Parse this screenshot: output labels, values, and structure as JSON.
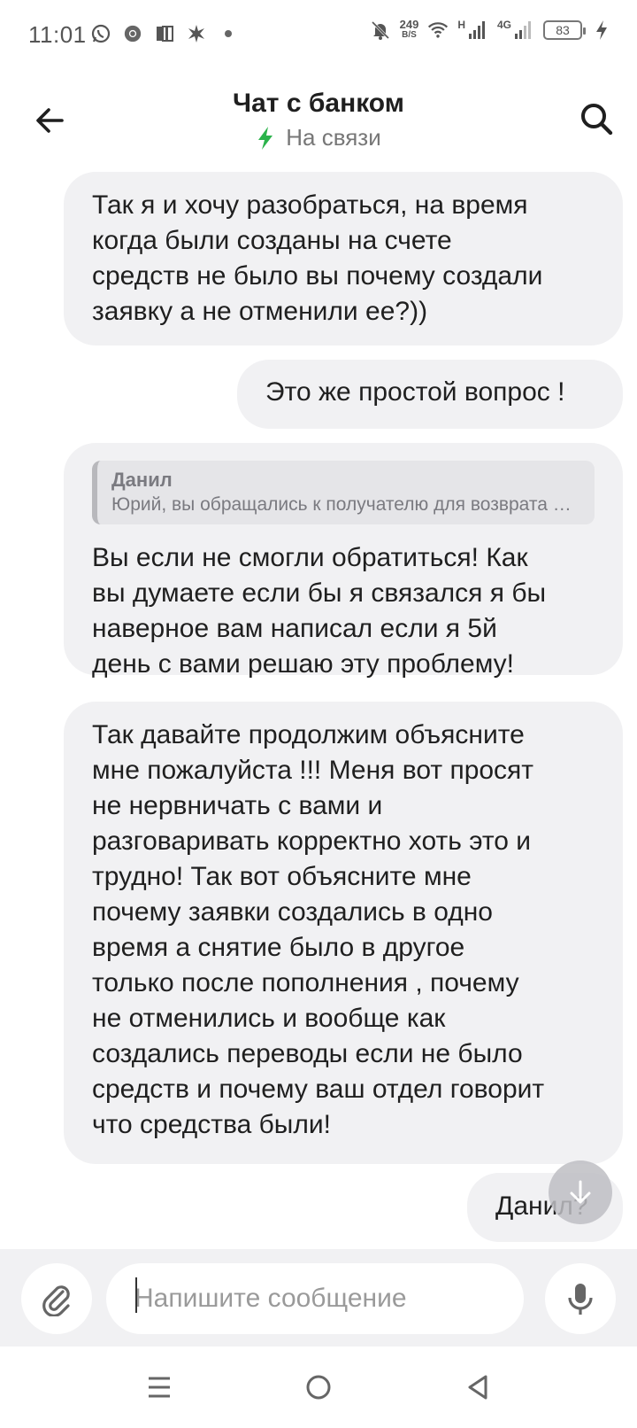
{
  "status_bar": {
    "time": "11:01",
    "net_speed_value": "249",
    "net_speed_unit": "B/S",
    "signal1_label": "H",
    "signal2_label": "4G",
    "battery": "83",
    "left_icons": [
      "whatsapp-icon",
      "chrome-icon",
      "app-icon",
      "notification-icon",
      "dot-icon"
    ],
    "right_icons": [
      "mute-icon",
      "wifi-icon",
      "signal-icon",
      "signal-icon",
      "battery-icon",
      "charging-icon"
    ]
  },
  "header": {
    "title": "Чат с банком",
    "status": "На связи",
    "status_color": "#2bb34b"
  },
  "messages": [
    {
      "id": "m1",
      "text": "Так я и хочу разобраться, на время\nкогда были созданы на счете\nсредств не было вы почему создали\nзаявку а не отменили ее?))"
    },
    {
      "id": "m2",
      "text": "Это же простой вопрос !"
    },
    {
      "id": "m3",
      "reply_author": "Данил",
      "reply_text": "Юрий, вы обращались к получателю для возврата средств?",
      "text": "Вы если не смогли обратиться! Как\nвы думаете если бы я связался я бы\nнаверное вам написал если я 5й\nдень с вами решаю эту проблему!"
    },
    {
      "id": "m4",
      "text": "Так давайте продолжим объясните\nмне пожалуйста !!! Меня вот просят\nне нервничать с вами и\nразговаривать корректно хоть это и\nтрудно! Так вот объясните мне\nпочему заявки создались в одно\nвремя а снятие было в другое\nтолько после пополнения , почему\nне отменились и вообще как\nсоздались переводы если не было\nсредств и почему ваш отдел говорит\nчто средства были!"
    },
    {
      "id": "m5",
      "text": "Данил?"
    }
  ],
  "composer": {
    "placeholder": "Напишите сообщение",
    "value": ""
  },
  "colors": {
    "bubble": "#f1f1f3",
    "accent": "#2bb34b",
    "text": "#1f1f1f",
    "muted": "#777777"
  }
}
